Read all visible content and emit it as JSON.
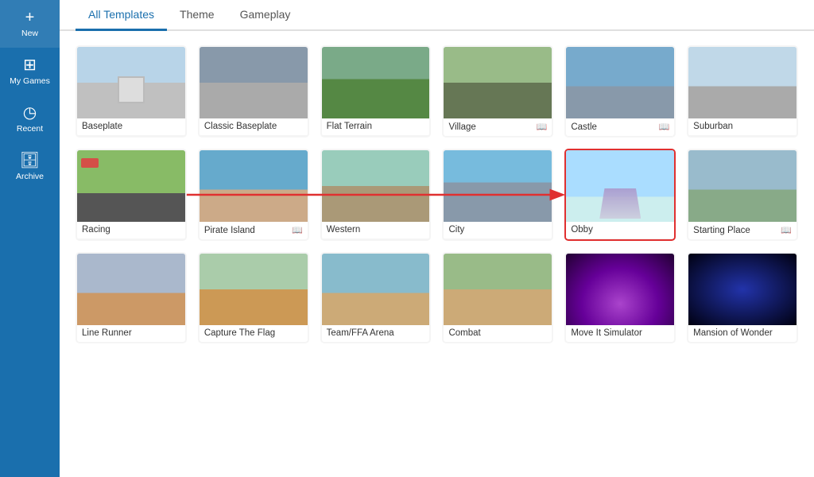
{
  "sidebar": {
    "items": [
      {
        "id": "new",
        "label": "New",
        "icon": "+"
      },
      {
        "id": "my-games",
        "label": "My Games",
        "icon": "⊞"
      },
      {
        "id": "recent",
        "label": "Recent",
        "icon": "◷"
      },
      {
        "id": "archive",
        "label": "Archive",
        "icon": "🗄"
      }
    ]
  },
  "tabs": [
    {
      "id": "all-templates",
      "label": "All Templates",
      "active": true
    },
    {
      "id": "theme",
      "label": "Theme",
      "active": false
    },
    {
      "id": "gameplay",
      "label": "Gameplay",
      "active": false
    }
  ],
  "templates": [
    {
      "id": "baseplate",
      "label": "Baseplate",
      "hasBook": false,
      "selected": false,
      "thumb": "baseplate"
    },
    {
      "id": "classic-baseplate",
      "label": "Classic Baseplate",
      "hasBook": false,
      "selected": false,
      "thumb": "classic"
    },
    {
      "id": "flat-terrain",
      "label": "Flat Terrain",
      "hasBook": false,
      "selected": false,
      "thumb": "flat"
    },
    {
      "id": "village",
      "label": "Village",
      "hasBook": true,
      "selected": false,
      "thumb": "village"
    },
    {
      "id": "castle",
      "label": "Castle",
      "hasBook": true,
      "selected": false,
      "thumb": "castle"
    },
    {
      "id": "suburban",
      "label": "Suburban",
      "hasBook": false,
      "selected": false,
      "thumb": "suburban"
    },
    {
      "id": "racing",
      "label": "Racing",
      "hasBook": false,
      "selected": false,
      "thumb": "racing"
    },
    {
      "id": "pirate-island",
      "label": "Pirate Island",
      "hasBook": true,
      "selected": false,
      "thumb": "pirate"
    },
    {
      "id": "western",
      "label": "Western",
      "hasBook": false,
      "selected": false,
      "thumb": "western"
    },
    {
      "id": "city",
      "label": "City",
      "hasBook": false,
      "selected": false,
      "thumb": "city"
    },
    {
      "id": "obby",
      "label": "Obby",
      "hasBook": false,
      "selected": true,
      "thumb": "obby"
    },
    {
      "id": "starting-place",
      "label": "Starting Place",
      "hasBook": true,
      "selected": false,
      "thumb": "starting"
    },
    {
      "id": "line-runner",
      "label": "Line Runner",
      "hasBook": false,
      "selected": false,
      "thumb": "linerunner"
    },
    {
      "id": "capture-the-flag",
      "label": "Capture The Flag",
      "hasBook": false,
      "selected": false,
      "thumb": "ctf"
    },
    {
      "id": "team-ffa-arena",
      "label": "Team/FFA Arena",
      "hasBook": false,
      "selected": false,
      "thumb": "ffa"
    },
    {
      "id": "combat",
      "label": "Combat",
      "hasBook": false,
      "selected": false,
      "thumb": "combat"
    },
    {
      "id": "move-it-simulator",
      "label": "Move It Simulator",
      "hasBook": false,
      "selected": false,
      "thumb": "moveit"
    },
    {
      "id": "mansion-of-wonder",
      "label": "Mansion of Wonder",
      "hasBook": false,
      "selected": false,
      "thumb": "mansion"
    }
  ],
  "arrow": {
    "visible": true,
    "from": "racing",
    "to": "obby"
  }
}
